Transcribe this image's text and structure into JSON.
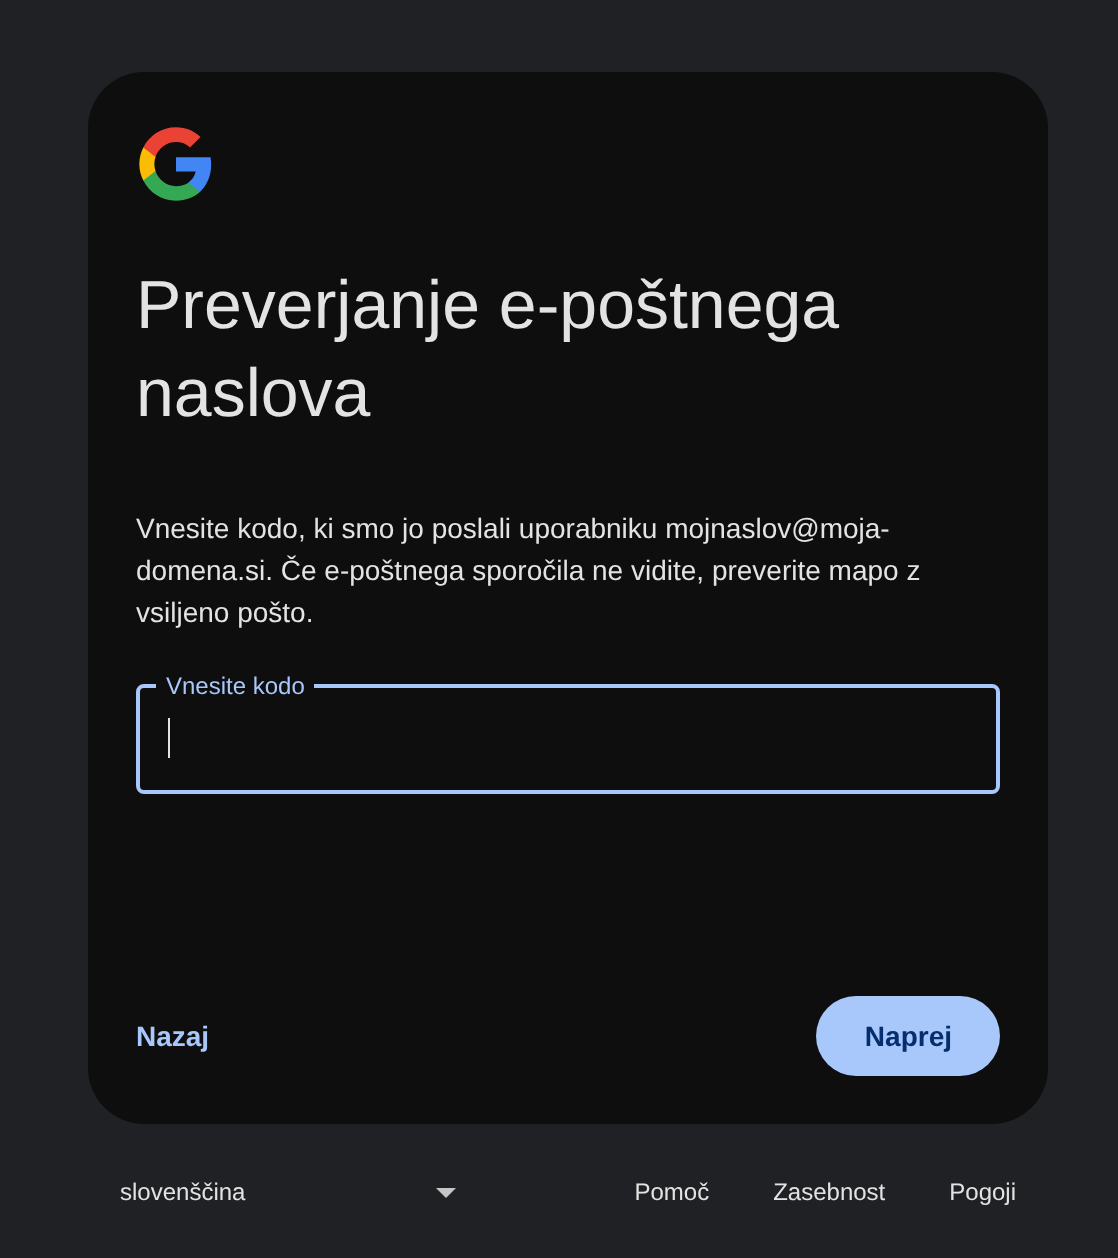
{
  "card": {
    "title": "Preverjanje e-poštnega naslova",
    "description": "Vnesite kodo, ki smo jo poslali uporabniku mojnaslov@moja-domena.si. Če e-poštnega sporočila ne vidite, preverite mapo z vsiljeno pošto.",
    "code_field": {
      "label": "Vnesite kodo",
      "focused": true
    },
    "buttons": [
      {
        "label": "Nazaj",
        "kind": "text"
      },
      {
        "label": "Naprej",
        "kind": "filled"
      }
    ]
  },
  "footer": {
    "language": "slovenščina",
    "links": [
      "Pomoč",
      "Zasebnost",
      "Pogoji"
    ]
  }
}
